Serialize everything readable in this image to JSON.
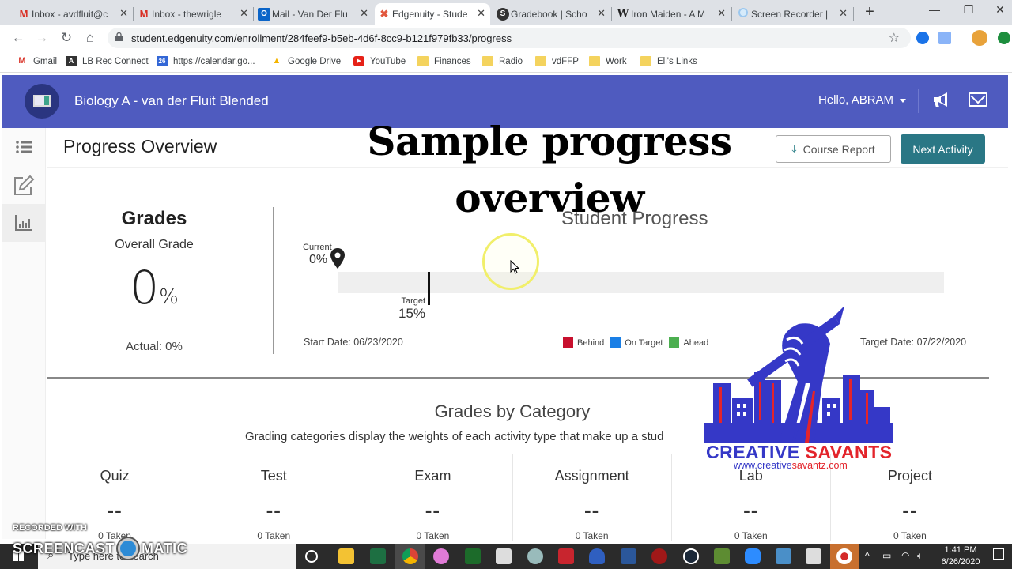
{
  "browser": {
    "tabs": [
      {
        "title": "Inbox - avdfluit@c",
        "icon": "gmail-icon",
        "active": false
      },
      {
        "title": "Inbox - thewrigle",
        "icon": "gmail-icon",
        "active": false
      },
      {
        "title": "Mail - Van Der Flu",
        "icon": "outlook-icon",
        "active": false
      },
      {
        "title": "Edgenuity - Stude",
        "icon": "edgenuity-icon",
        "active": true
      },
      {
        "title": "Gradebook | Scho",
        "icon": "schoology-icon",
        "active": false
      },
      {
        "title": "Iron Maiden - A M",
        "icon": "wikipedia-icon",
        "active": false
      },
      {
        "title": "Screen Recorder |",
        "icon": "screencast-icon",
        "active": false
      }
    ],
    "new_tab": "+",
    "url": "student.edgenuity.com/enrollment/284feef9-b5eb-4d6f-8cc9-b121f979fb33/progress",
    "bookmarks": [
      {
        "label": "Gmail",
        "icon": "gmail-icon"
      },
      {
        "label": "LB Rec Connect",
        "icon": "lb-rec-icon"
      },
      {
        "label": "https://calendar.go...",
        "icon": "calendar-icon"
      },
      {
        "label": "Google Drive",
        "icon": "google-drive-icon"
      },
      {
        "label": "YouTube",
        "icon": "youtube-icon"
      },
      {
        "label": "Finances",
        "icon": "folder-icon"
      },
      {
        "label": "Radio",
        "icon": "folder-icon"
      },
      {
        "label": "vdFFP",
        "icon": "folder-icon"
      },
      {
        "label": "Work",
        "icon": "folder-icon"
      },
      {
        "label": "Eli's Links",
        "icon": "folder-icon"
      }
    ]
  },
  "app": {
    "course_title": "Biology A - van der Fluit Blended",
    "greeting": "Hello, ABRAM",
    "colors": {
      "header": "#4f5bbf",
      "primary_button": "#2a7785"
    }
  },
  "page": {
    "title": "Progress Overview",
    "course_report_label": "Course Report",
    "next_activity_label": "Next Activity"
  },
  "grades": {
    "heading": "Grades",
    "overall_label": "Overall Grade",
    "overall_value": "0",
    "overall_unit": "%",
    "actual": "Actual: 0%"
  },
  "student_progress": {
    "title": "Student Progress",
    "current_label": "Current",
    "current_value": "0%",
    "current_percent": 0,
    "target_label": "Target",
    "target_value": "15%",
    "target_percent": 15,
    "start_date": "Start Date: 06/23/2020",
    "target_date": "Target Date: 07/22/2020",
    "legend": [
      {
        "label": "Behind",
        "color": "#c8102e"
      },
      {
        "label": "On Target",
        "color": "#1a7fe6"
      },
      {
        "label": "Ahead",
        "color": "#4caf50"
      }
    ]
  },
  "grades_by_category": {
    "title": "Grades by Category",
    "description": "Grading categories display the weights of each activity type that make up a stud",
    "categories": [
      {
        "name": "Quiz",
        "value": "--",
        "taken": "0 Taken"
      },
      {
        "name": "Test",
        "value": "--",
        "taken": "0 Taken"
      },
      {
        "name": "Exam",
        "value": "--",
        "taken": "0 Taken"
      },
      {
        "name": "Assignment",
        "value": "--",
        "taken": "0 Taken"
      },
      {
        "name": "Lab",
        "value": "--",
        "taken": "0 Taken"
      },
      {
        "name": "Project",
        "value": "--",
        "taken": "0 Taken"
      }
    ]
  },
  "overlay": {
    "title": "Sample progress overview",
    "brand_name_a": "CREATIVE ",
    "brand_name_b": "SAVANTS",
    "brand_url_a": "www.creative",
    "brand_url_b": "savantz.com",
    "recorder_line1": "RECORDED WITH",
    "recorder_brand_a": "SCREENCAST",
    "recorder_brand_b": "MATIC"
  },
  "taskbar": {
    "search_placeholder": "Type here to search",
    "time": "1:41 PM",
    "date": "6/26/2020"
  }
}
